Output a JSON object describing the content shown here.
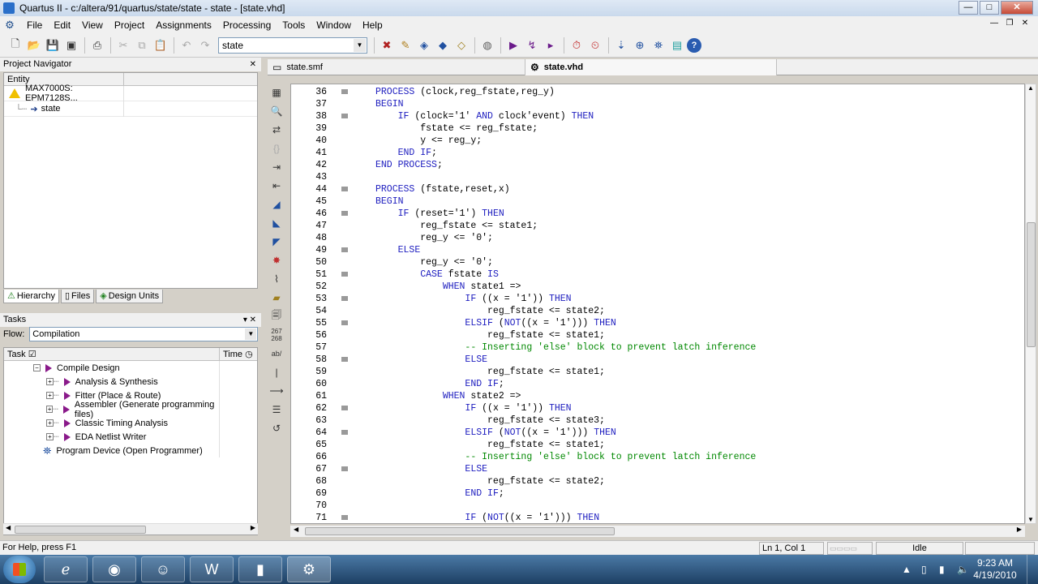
{
  "window": {
    "title": "Quartus II - c:/altera/91/quartus/state/state - state - [state.vhd]"
  },
  "menu": [
    "File",
    "Edit",
    "View",
    "Project",
    "Assignments",
    "Processing",
    "Tools",
    "Window",
    "Help"
  ],
  "toolbar": {
    "entity_combo": "state"
  },
  "project_navigator": {
    "title": "Project Navigator",
    "col_entity": "Entity",
    "device": "MAX7000S: EPM7128S...",
    "top_entity": "state",
    "tabs": [
      "Hierarchy",
      "Files",
      "Design Units"
    ]
  },
  "tasks": {
    "title": "Tasks",
    "flow_label": "Flow:",
    "flow_value": "Compilation",
    "col_task": "Task",
    "col_time": "Time",
    "items": [
      {
        "label": "Compile Design",
        "level": 0
      },
      {
        "label": "Analysis & Synthesis",
        "level": 1
      },
      {
        "label": "Fitter (Place & Route)",
        "level": 1
      },
      {
        "label": "Assembler (Generate programming files)",
        "level": 1
      },
      {
        "label": "Classic Timing Analysis",
        "level": 1
      },
      {
        "label": "EDA Netlist Writer",
        "level": 1
      },
      {
        "label": "Program Device (Open Programmer)",
        "level": 0
      }
    ]
  },
  "editor_tabs": [
    "state.smf",
    "state.vhd"
  ],
  "vtoolbar": {
    "line_counter": "267\n268",
    "ab_label": "ab/"
  },
  "code_lines": [
    {
      "n": "36",
      "fold": true,
      "code": "PROCESS (clock,reg_fstate,reg_y)"
    },
    {
      "n": "37",
      "fold": false,
      "code": "BEGIN"
    },
    {
      "n": "38",
      "fold": true,
      "code": "    IF (clock='1' AND clock'event) THEN"
    },
    {
      "n": "39",
      "fold": false,
      "code": "        fstate <= reg_fstate;"
    },
    {
      "n": "40",
      "fold": false,
      "code": "        y <= reg_y;"
    },
    {
      "n": "41",
      "fold": false,
      "code": "    END IF;"
    },
    {
      "n": "42",
      "fold": false,
      "code": "END PROCESS;"
    },
    {
      "n": "43",
      "fold": false,
      "code": ""
    },
    {
      "n": "44",
      "fold": true,
      "code": "PROCESS (fstate,reset,x)"
    },
    {
      "n": "45",
      "fold": false,
      "code": "BEGIN"
    },
    {
      "n": "46",
      "fold": true,
      "code": "    IF (reset='1') THEN"
    },
    {
      "n": "47",
      "fold": false,
      "code": "        reg_fstate <= state1;"
    },
    {
      "n": "48",
      "fold": false,
      "code": "        reg_y <= '0';"
    },
    {
      "n": "49",
      "fold": true,
      "code": "    ELSE"
    },
    {
      "n": "50",
      "fold": false,
      "code": "        reg_y <= '0';"
    },
    {
      "n": "51",
      "fold": true,
      "code": "        CASE fstate IS"
    },
    {
      "n": "52",
      "fold": false,
      "code": "            WHEN state1 =>"
    },
    {
      "n": "53",
      "fold": true,
      "code": "                IF ((x = '1')) THEN"
    },
    {
      "n": "54",
      "fold": false,
      "code": "                    reg_fstate <= state2;"
    },
    {
      "n": "55",
      "fold": true,
      "code": "                ELSIF (NOT((x = '1'))) THEN"
    },
    {
      "n": "56",
      "fold": false,
      "code": "                    reg_fstate <= state1;"
    },
    {
      "n": "57",
      "fold": false,
      "code": "                -- Inserting 'else' block to prevent latch inference"
    },
    {
      "n": "58",
      "fold": true,
      "code": "                ELSE"
    },
    {
      "n": "59",
      "fold": false,
      "code": "                    reg_fstate <= state1;"
    },
    {
      "n": "60",
      "fold": false,
      "code": "                END IF;"
    },
    {
      "n": "61",
      "fold": false,
      "code": "            WHEN state2 =>"
    },
    {
      "n": "62",
      "fold": true,
      "code": "                IF ((x = '1')) THEN"
    },
    {
      "n": "63",
      "fold": false,
      "code": "                    reg_fstate <= state3;"
    },
    {
      "n": "64",
      "fold": true,
      "code": "                ELSIF (NOT((x = '1'))) THEN"
    },
    {
      "n": "65",
      "fold": false,
      "code": "                    reg_fstate <= state1;"
    },
    {
      "n": "66",
      "fold": false,
      "code": "                -- Inserting 'else' block to prevent latch inference"
    },
    {
      "n": "67",
      "fold": true,
      "code": "                ELSE"
    },
    {
      "n": "68",
      "fold": false,
      "code": "                    reg_fstate <= state2;"
    },
    {
      "n": "69",
      "fold": false,
      "code": "                END IF;"
    },
    {
      "n": "70",
      "fold": false,
      "code": ""
    },
    {
      "n": "71",
      "fold": true,
      "code": "                IF (NOT((x = '1'))) THEN"
    }
  ],
  "status": {
    "help": "For Help, press F1",
    "position": "Ln 1, Col 1",
    "state": "Idle"
  },
  "taskbar": {
    "time": "9:23 AM",
    "date": "4/19/2010"
  }
}
